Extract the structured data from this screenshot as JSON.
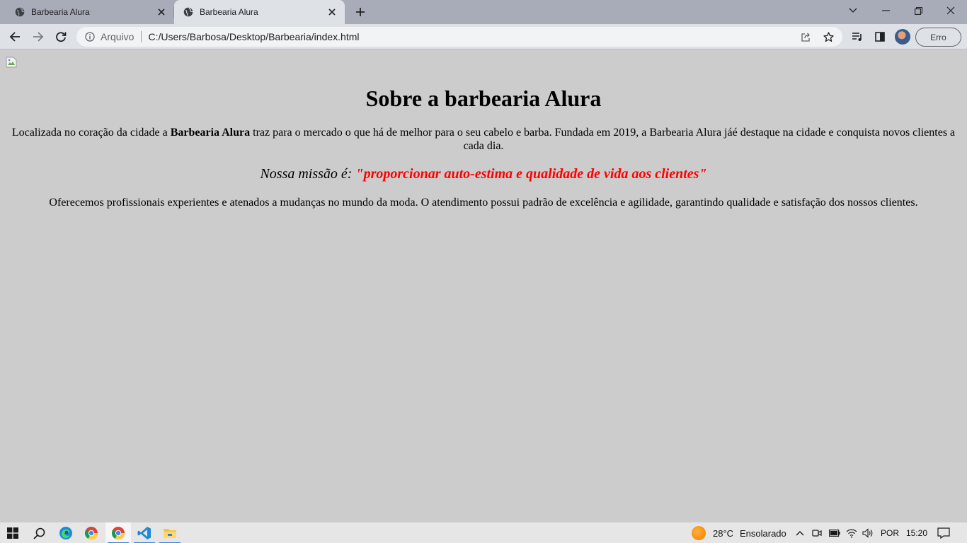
{
  "browser": {
    "tabs": [
      {
        "title": "Barbearia Alura",
        "active": false
      },
      {
        "title": "Barbearia Alura",
        "active": true
      }
    ],
    "omnibox": {
      "scheme_label": "Arquivo",
      "url": "C:/Users/Barbosa/Desktop/Barbearia/index.html"
    },
    "profile_button": "Erro"
  },
  "page": {
    "heading": "Sobre a barbearia Alura",
    "paragraph1": {
      "before": "Localizada no coração da cidade a ",
      "bold": "Barbearia Alura",
      "after": " traz para o mercado o que há de melhor para o seu cabelo e barba. Fundada em 2019, a Barbearia Alura jáé destaque na cidade e conquista novos clientes a cada dia."
    },
    "mission": {
      "prefix": "Nossa missão é: ",
      "highlight": "\"proporcionar auto-estima e qualidade de vida aos clientes\""
    },
    "paragraph2": "Oferecemos profissionais experientes e atenados a mudanças no mundo da moda. O atendimento possui padrão de excelência e agilidade, garantindo qualidade e satisfação dos nossos clientes."
  },
  "taskbar": {
    "apps": [
      "windows-start-icon",
      "search-icon",
      "edge-icon",
      "chrome-icon",
      "chrome-icon",
      "vscode-icon",
      "file-explorer-icon"
    ],
    "weather": {
      "temperature": "28°C",
      "condition": "Ensolarado"
    },
    "language": "POR",
    "time": "15:20"
  },
  "colors": {
    "page_background": "#cccccc",
    "mission_highlight": "#ff0000",
    "tabstrip": "#a8acb8",
    "toolbar": "#dee1e6"
  }
}
